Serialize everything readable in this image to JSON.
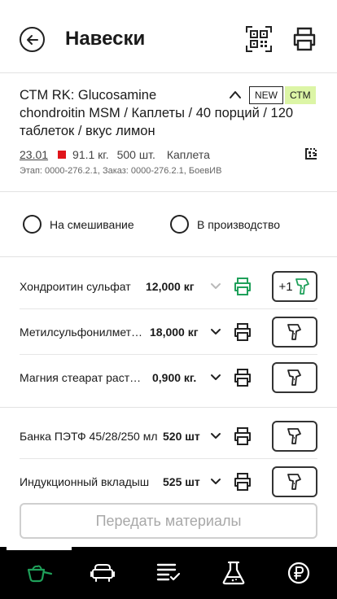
{
  "header": {
    "title": "Навески"
  },
  "product": {
    "name_line1": "СТМ RK: Glucosamine",
    "name_rest": "chondroitin MSM / Каплеты / 40 порций / 120 таблеток / вкус лимон",
    "badge_new": "NEW",
    "badge_ctm": "СТМ",
    "date": "23.01",
    "weight": "91.1 кг.",
    "qty": "500 шт.",
    "form": "Каплета",
    "stage": "Этап: 0000-276.2.1, Заказ: 0000-276.2.1, БоевИВ",
    "status_color": "#e0151b",
    "badge_ctm_color": "#dcf5a6"
  },
  "radios": {
    "mix_label": "На смешивание",
    "production_label": "В производство"
  },
  "materials": [
    {
      "name": "Хондроитин сульфат",
      "qty": "12,000 кг",
      "scan_label": "+1",
      "done": true
    },
    {
      "name": "Метилсульфонилметан",
      "qty": "18,000 кг",
      "scan_label": "",
      "done": false
    },
    {
      "name": "Магния стеарат растительный",
      "qty": "0,900 кг.",
      "scan_label": "",
      "done": false
    }
  ],
  "packaging": [
    {
      "name": "Банка ПЭТФ 45/28/250 мл",
      "qty": "520 шт",
      "scan_label": ""
    },
    {
      "name": "Индукционный вкладыш",
      "qty": "525 шт",
      "scan_label": ""
    }
  ],
  "submit": {
    "label": "Передать материалы"
  },
  "colors": {
    "accent_green": "#1fa05a",
    "nav_bg": "#000000"
  },
  "bottom_nav": [
    {
      "icon": "scoop-icon",
      "active": true
    },
    {
      "icon": "mixer-icon",
      "active": false
    },
    {
      "icon": "checklist-icon",
      "active": false
    },
    {
      "icon": "flask-icon",
      "active": false
    },
    {
      "icon": "ruble-icon",
      "active": false
    }
  ]
}
